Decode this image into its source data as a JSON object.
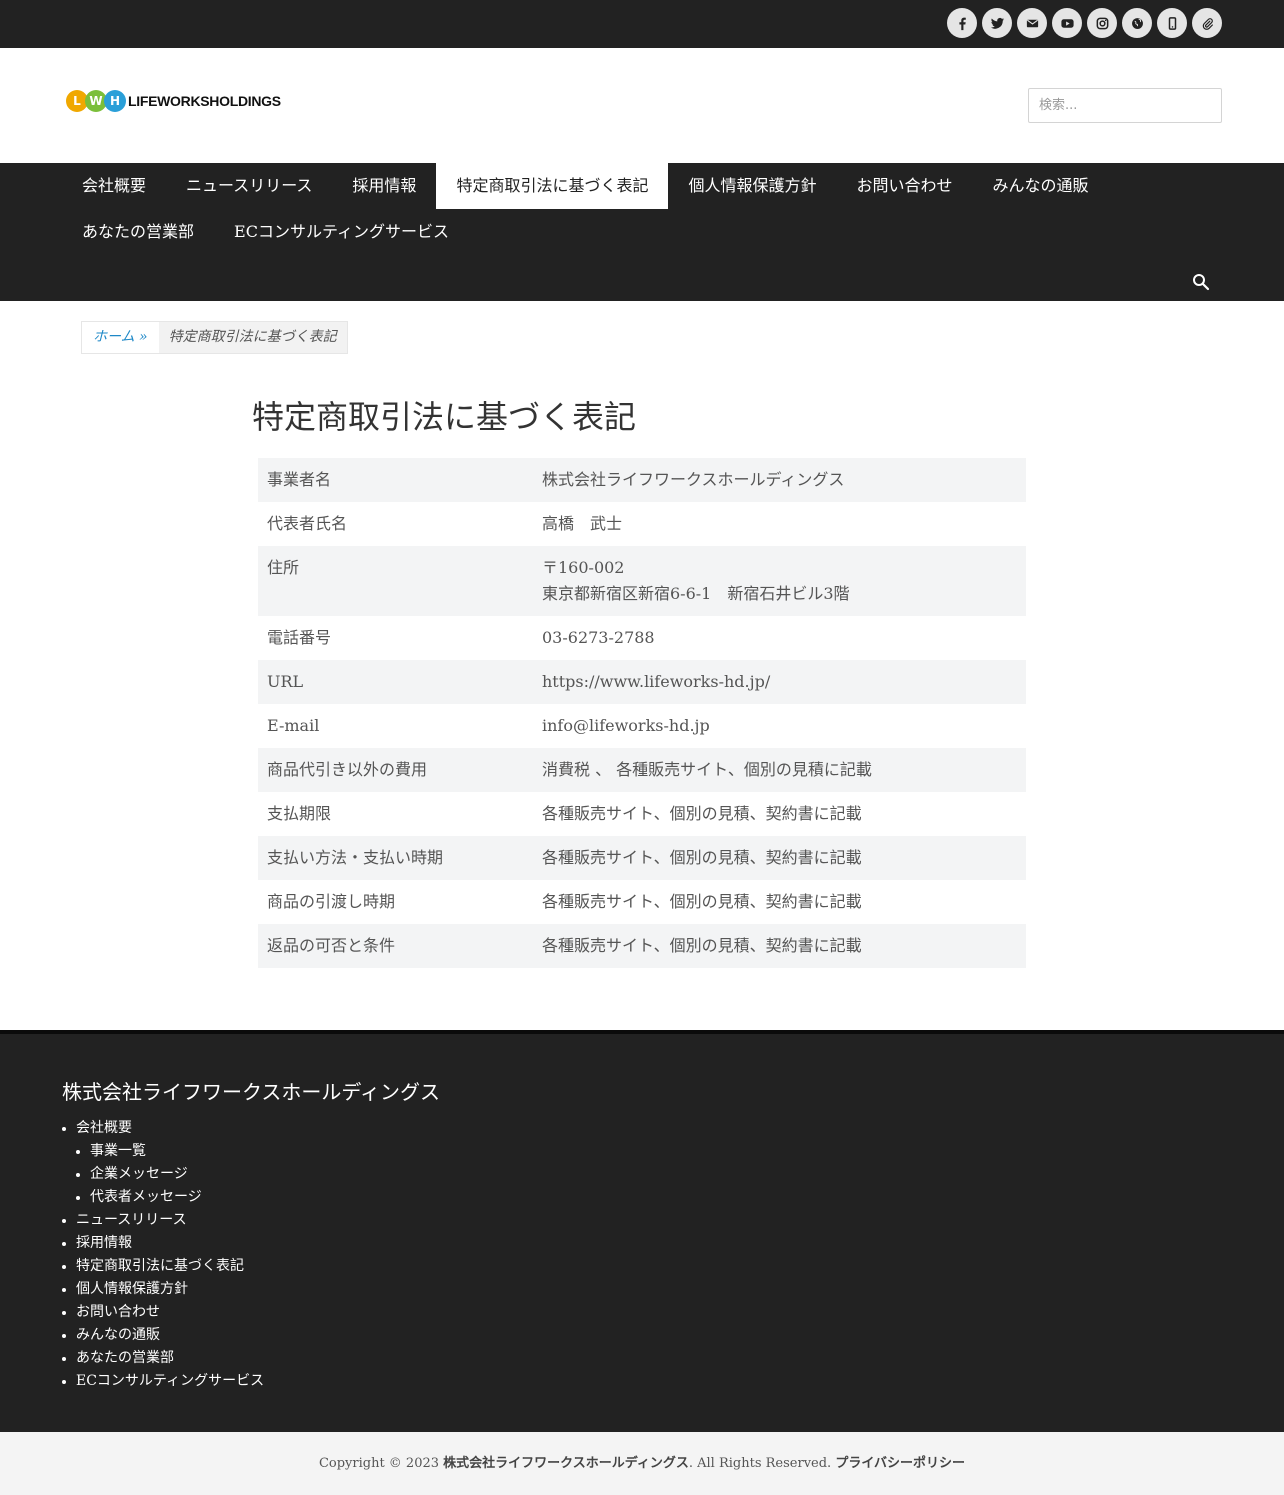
{
  "social": {
    "icons": [
      "facebook-icon",
      "twitter-icon",
      "mail-icon",
      "youtube-icon",
      "instagram-icon",
      "globe-icon",
      "mobile-icon",
      "clip-icon"
    ]
  },
  "header": {
    "logo": {
      "letters": [
        "L",
        "W",
        "H"
      ],
      "text": "LIFEWORKSHOLDINGS",
      "colors": [
        "#f0a800",
        "#7bbf3a",
        "#2a9fd8"
      ]
    },
    "search_placeholder": "検索..."
  },
  "nav": {
    "items": [
      {
        "label": "会社概要"
      },
      {
        "label": "ニュースリリース"
      },
      {
        "label": "採用情報"
      },
      {
        "label": "特定商取引法に基づく表記",
        "active": true
      },
      {
        "label": "個人情報保護方針"
      },
      {
        "label": "お問い合わせ"
      },
      {
        "label": "みんなの通販"
      },
      {
        "label": "あなたの営業部"
      },
      {
        "label": "ECコンサルティングサービス"
      }
    ]
  },
  "breadcrumb": {
    "home": "ホーム »",
    "current": "特定商取引法に基づく表記"
  },
  "main": {
    "title": "特定商取引法に基づく表記",
    "table": {
      "rows": [
        {
          "key": "事業者名",
          "value": "株式会社ライフワークスホールディングス"
        },
        {
          "key": "代表者氏名",
          "value": "高橋　武士"
        },
        {
          "key": "住所",
          "value": "〒160-002",
          "value2": "東京都新宿区新宿6-6-1　新宿石井ビル3階"
        },
        {
          "key": "電話番号",
          "value": "03-6273-2788"
        },
        {
          "key": "URL",
          "value": "https://www.lifeworks-hd.jp/"
        },
        {
          "key": "E-mail",
          "value": "info@lifeworks-hd.jp"
        },
        {
          "key": "商品代引き以外の費用",
          "value": "消費税 、 各種販売サイト、個別の見積に記載"
        },
        {
          "key": "支払期限",
          "value": "各種販売サイト、個別の見積、契約書に記載"
        },
        {
          "key": "支払い方法・支払い時期",
          "value": "各種販売サイト、個別の見積、契約書に記載"
        },
        {
          "key": "商品の引渡し時期",
          "value": "各種販売サイト、個別の見積、契約書に記載"
        },
        {
          "key": "返品の可否と条件",
          "value": "各種販売サイト、個別の見積、契約書に記載"
        }
      ]
    }
  },
  "footer": {
    "title": "株式会社ライフワークスホールディングス",
    "links": [
      {
        "label": "会社概要"
      },
      {
        "label": "事業一覧",
        "sub": true
      },
      {
        "label": "企業メッセージ",
        "sub": true
      },
      {
        "label": "代表者メッセージ",
        "sub": true
      },
      {
        "label": "ニュースリリース"
      },
      {
        "label": "採用情報"
      },
      {
        "label": "特定商取引法に基づく表記"
      },
      {
        "label": "個人情報保護方針"
      },
      {
        "label": "お問い合わせ"
      },
      {
        "label": "みんなの通販"
      },
      {
        "label": "あなたの営業部"
      },
      {
        "label": "ECコンサルティングサービス"
      }
    ]
  },
  "copyright": {
    "prefix": "Copyright © 2023 ",
    "company": "株式会社ライフワークスホールディングス",
    "middle": ". All Rights Reserved. ",
    "policy": "プライバシーポリシー"
  }
}
